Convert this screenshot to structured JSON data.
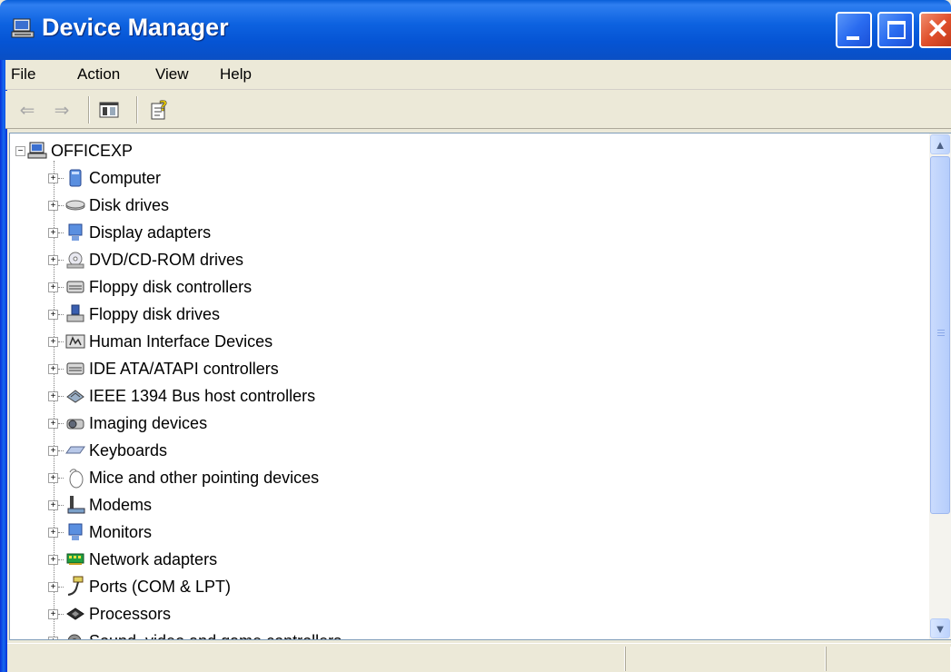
{
  "window": {
    "title": "Device Manager",
    "title_icon": "computer-icon"
  },
  "menu": [
    "File",
    "Action",
    "View",
    "Help"
  ],
  "toolbar": {
    "back_icon": "back-arrow-icon",
    "forward_icon": "forward-arrow-icon",
    "show_hide_icon": "show-hide-console-tree-icon",
    "properties_icon": "properties-icon"
  },
  "tree": {
    "root": {
      "label": "OFFICEXP",
      "icon": "computer-icon"
    },
    "items": [
      {
        "label": "Computer",
        "icon": "computer-icon"
      },
      {
        "label": "Disk drives",
        "icon": "disk-drive-icon"
      },
      {
        "label": "Display adapters",
        "icon": "display-adapter-icon"
      },
      {
        "label": "DVD/CD-ROM drives",
        "icon": "cdrom-icon"
      },
      {
        "label": "Floppy disk controllers",
        "icon": "controller-icon"
      },
      {
        "label": "Floppy disk drives",
        "icon": "floppy-drive-icon"
      },
      {
        "label": "Human Interface Devices",
        "icon": "hid-icon"
      },
      {
        "label": "IDE ATA/ATAPI controllers",
        "icon": "controller-icon"
      },
      {
        "label": "IEEE 1394 Bus host controllers",
        "icon": "ieee1394-icon"
      },
      {
        "label": "Imaging devices",
        "icon": "camera-icon"
      },
      {
        "label": "Keyboards",
        "icon": "keyboard-icon"
      },
      {
        "label": "Mice and other pointing devices",
        "icon": "mouse-icon"
      },
      {
        "label": "Modems",
        "icon": "modem-icon"
      },
      {
        "label": "Monitors",
        "icon": "monitor-icon"
      },
      {
        "label": "Network adapters",
        "icon": "network-adapter-icon"
      },
      {
        "label": "Ports (COM & LPT)",
        "icon": "port-icon"
      },
      {
        "label": "Processors",
        "icon": "processor-icon"
      },
      {
        "label": "Sound, video and game controllers",
        "icon": "sound-icon"
      }
    ]
  },
  "colors": {
    "titlebar": "#0554d4",
    "close_button": "#e0502c",
    "window_bg": "#ece9d8"
  }
}
